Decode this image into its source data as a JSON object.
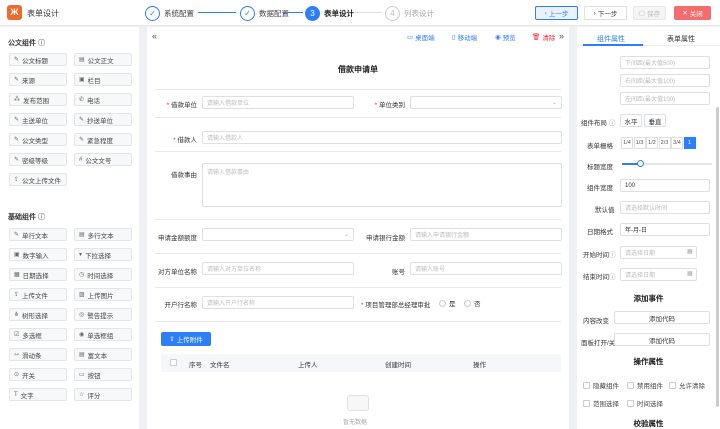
{
  "app": {
    "logo": "Ж",
    "title": "表单设计"
  },
  "steps": [
    {
      "num": "✓",
      "label": "系统配置"
    },
    {
      "num": "✓",
      "label": "数据配置"
    },
    {
      "num": "3",
      "label": "表单设计"
    },
    {
      "num": "4",
      "label": "列表设计"
    }
  ],
  "top_buttons": {
    "prev": "上一步",
    "next": "下一步",
    "save": "保存",
    "close": "关闭"
  },
  "sidebar": {
    "public_title": "公文组件",
    "public": [
      "公文标题",
      "公文正文",
      "来源",
      "栏目",
      "发布范围",
      "电话",
      "主送单位",
      "抄送单位",
      "公文类型",
      "紧急程度",
      "密级等级",
      "公文文号",
      "公文上传文件"
    ],
    "basic_title": "基础组件",
    "basic": [
      "单行文本",
      "多行文本",
      "数字输入",
      "下拉选择",
      "日期选择",
      "时间选择",
      "上传文件",
      "上传图片",
      "树形选择",
      "警告提示",
      "多选框",
      "单选框组",
      "滑动条",
      "富文本",
      "开关",
      "按钮",
      "文字",
      "评分"
    ]
  },
  "canvas": {
    "collapse": "«",
    "expand": "»",
    "tools": [
      "桌面端",
      "移动端",
      "预览",
      "清除"
    ],
    "form_title": "借款申请单",
    "fields": {
      "unit_label": "借款单位",
      "unit_ph": "请输入借款单位",
      "type_label": "单位类别",
      "person_label": "借款人",
      "person_ph": "请输入借款人",
      "reason_label": "借款事由",
      "reason_ph": "请输入借款事由",
      "amount_label": "申请金额额度",
      "bank_amount_label": "申请银行金额",
      "bank_amount_ph": "请输入申请银行金额",
      "party_label": "对方单位名称",
      "party_ph": "请输入对方单位名称",
      "account_label": "账号",
      "account_ph": "请输入账号",
      "bank_label": "开户行名称",
      "bank_ph": "请输入开户行名称",
      "approve_label": "项目管理部总经理审批",
      "yes": "是",
      "no": "否"
    },
    "upload_label": "上传附件",
    "table_headers": [
      "序号",
      "文件名",
      "上传人",
      "创建时间",
      "操作"
    ],
    "empty_text": "暂无数据"
  },
  "right": {
    "tabs": [
      "组件属性",
      "表单属性"
    ],
    "margins": [
      "下间距(最大值500)",
      "右间距(最大值100)",
      "左间距(最大值100)"
    ],
    "layout_label": "组件布局",
    "layout_h": "水平",
    "layout_v": "垂直",
    "grid_label": "表单栅格",
    "grid_opts": [
      "1/4",
      "1/3",
      "1/2",
      "2/3",
      "3/4",
      "1"
    ],
    "title_width_label": "标题宽度",
    "title_width_percent": 20,
    "comp_width_label": "组件宽度",
    "comp_width_value": "100",
    "default_label": "默认值",
    "default_ph": "请选择默认时间",
    "date_fmt_label": "日期格式",
    "date_fmt_value": "年-月-日",
    "start_label": "开始时间",
    "start_ph": "请选择日期",
    "end_label": "结束时间",
    "end_ph": "请选择日期",
    "event_title": "添加事件",
    "content_change": "内容改变",
    "add_code": "添加代码",
    "panel_open": "面板打开/关",
    "ops_title": "操作属性",
    "ops": [
      "隐藏组件",
      "禁用组件",
      "允许清除",
      "范围选择",
      "时间选择"
    ],
    "check_title": "校验属性"
  }
}
